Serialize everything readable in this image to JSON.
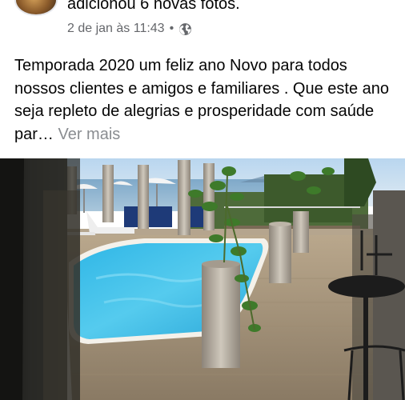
{
  "post": {
    "author_action": "adicionou 6 novas fotos.",
    "timestamp": "2 de jan às 11:43",
    "separator": "•",
    "privacy_icon": "globe-icon",
    "text": "Temporada 2020 um feliz ano Novo para todos nossos clientes e amigos e familiares . Que este ano seja repleto de alegrias e prosperidade com saúde par…",
    "see_more": "Ver mais"
  },
  "colors": {
    "text": "#050505",
    "meta": "#65676b",
    "see_more": "#8a8d91",
    "pool_water": "#3fc0e8",
    "deck": "#c8b89e"
  }
}
